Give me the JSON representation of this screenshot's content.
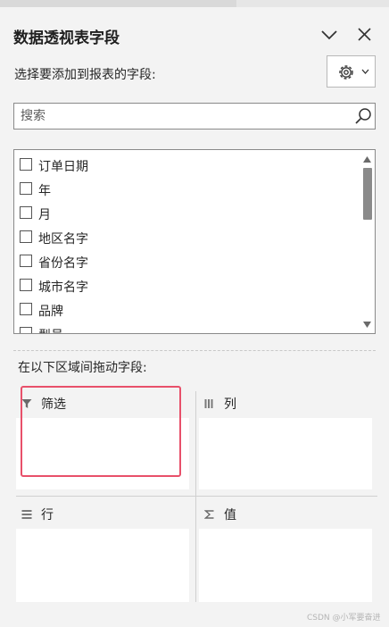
{
  "panel": {
    "title": "数据透视表字段",
    "collapse_icon": "chevron-down-icon",
    "close_icon": "close-icon"
  },
  "chooser": {
    "label": "选择要添加到报表的字段:",
    "settings_icon": "gear-icon"
  },
  "search": {
    "placeholder": "搜索",
    "value": ""
  },
  "fields": [
    {
      "label": "订单日期",
      "checked": false
    },
    {
      "label": "年",
      "checked": false
    },
    {
      "label": "月",
      "checked": false
    },
    {
      "label": "地区名字",
      "checked": false
    },
    {
      "label": "省份名字",
      "checked": false
    },
    {
      "label": "城市名字",
      "checked": false
    },
    {
      "label": "品牌",
      "checked": false
    },
    {
      "label": "型号",
      "checked": false
    }
  ],
  "areas": {
    "label": "在以下区域间拖动字段:",
    "filter": {
      "label": "筛选",
      "icon": "filter-icon"
    },
    "columns": {
      "label": "列",
      "icon": "columns-icon"
    },
    "rows": {
      "label": "行",
      "icon": "rows-icon"
    },
    "values": {
      "label": "值",
      "icon": "sigma-icon"
    }
  },
  "watermark": "CSDN @小军要奋进",
  "colors": {
    "highlight": "#e8506a",
    "scroll_thumb": "#8a8a8a"
  }
}
